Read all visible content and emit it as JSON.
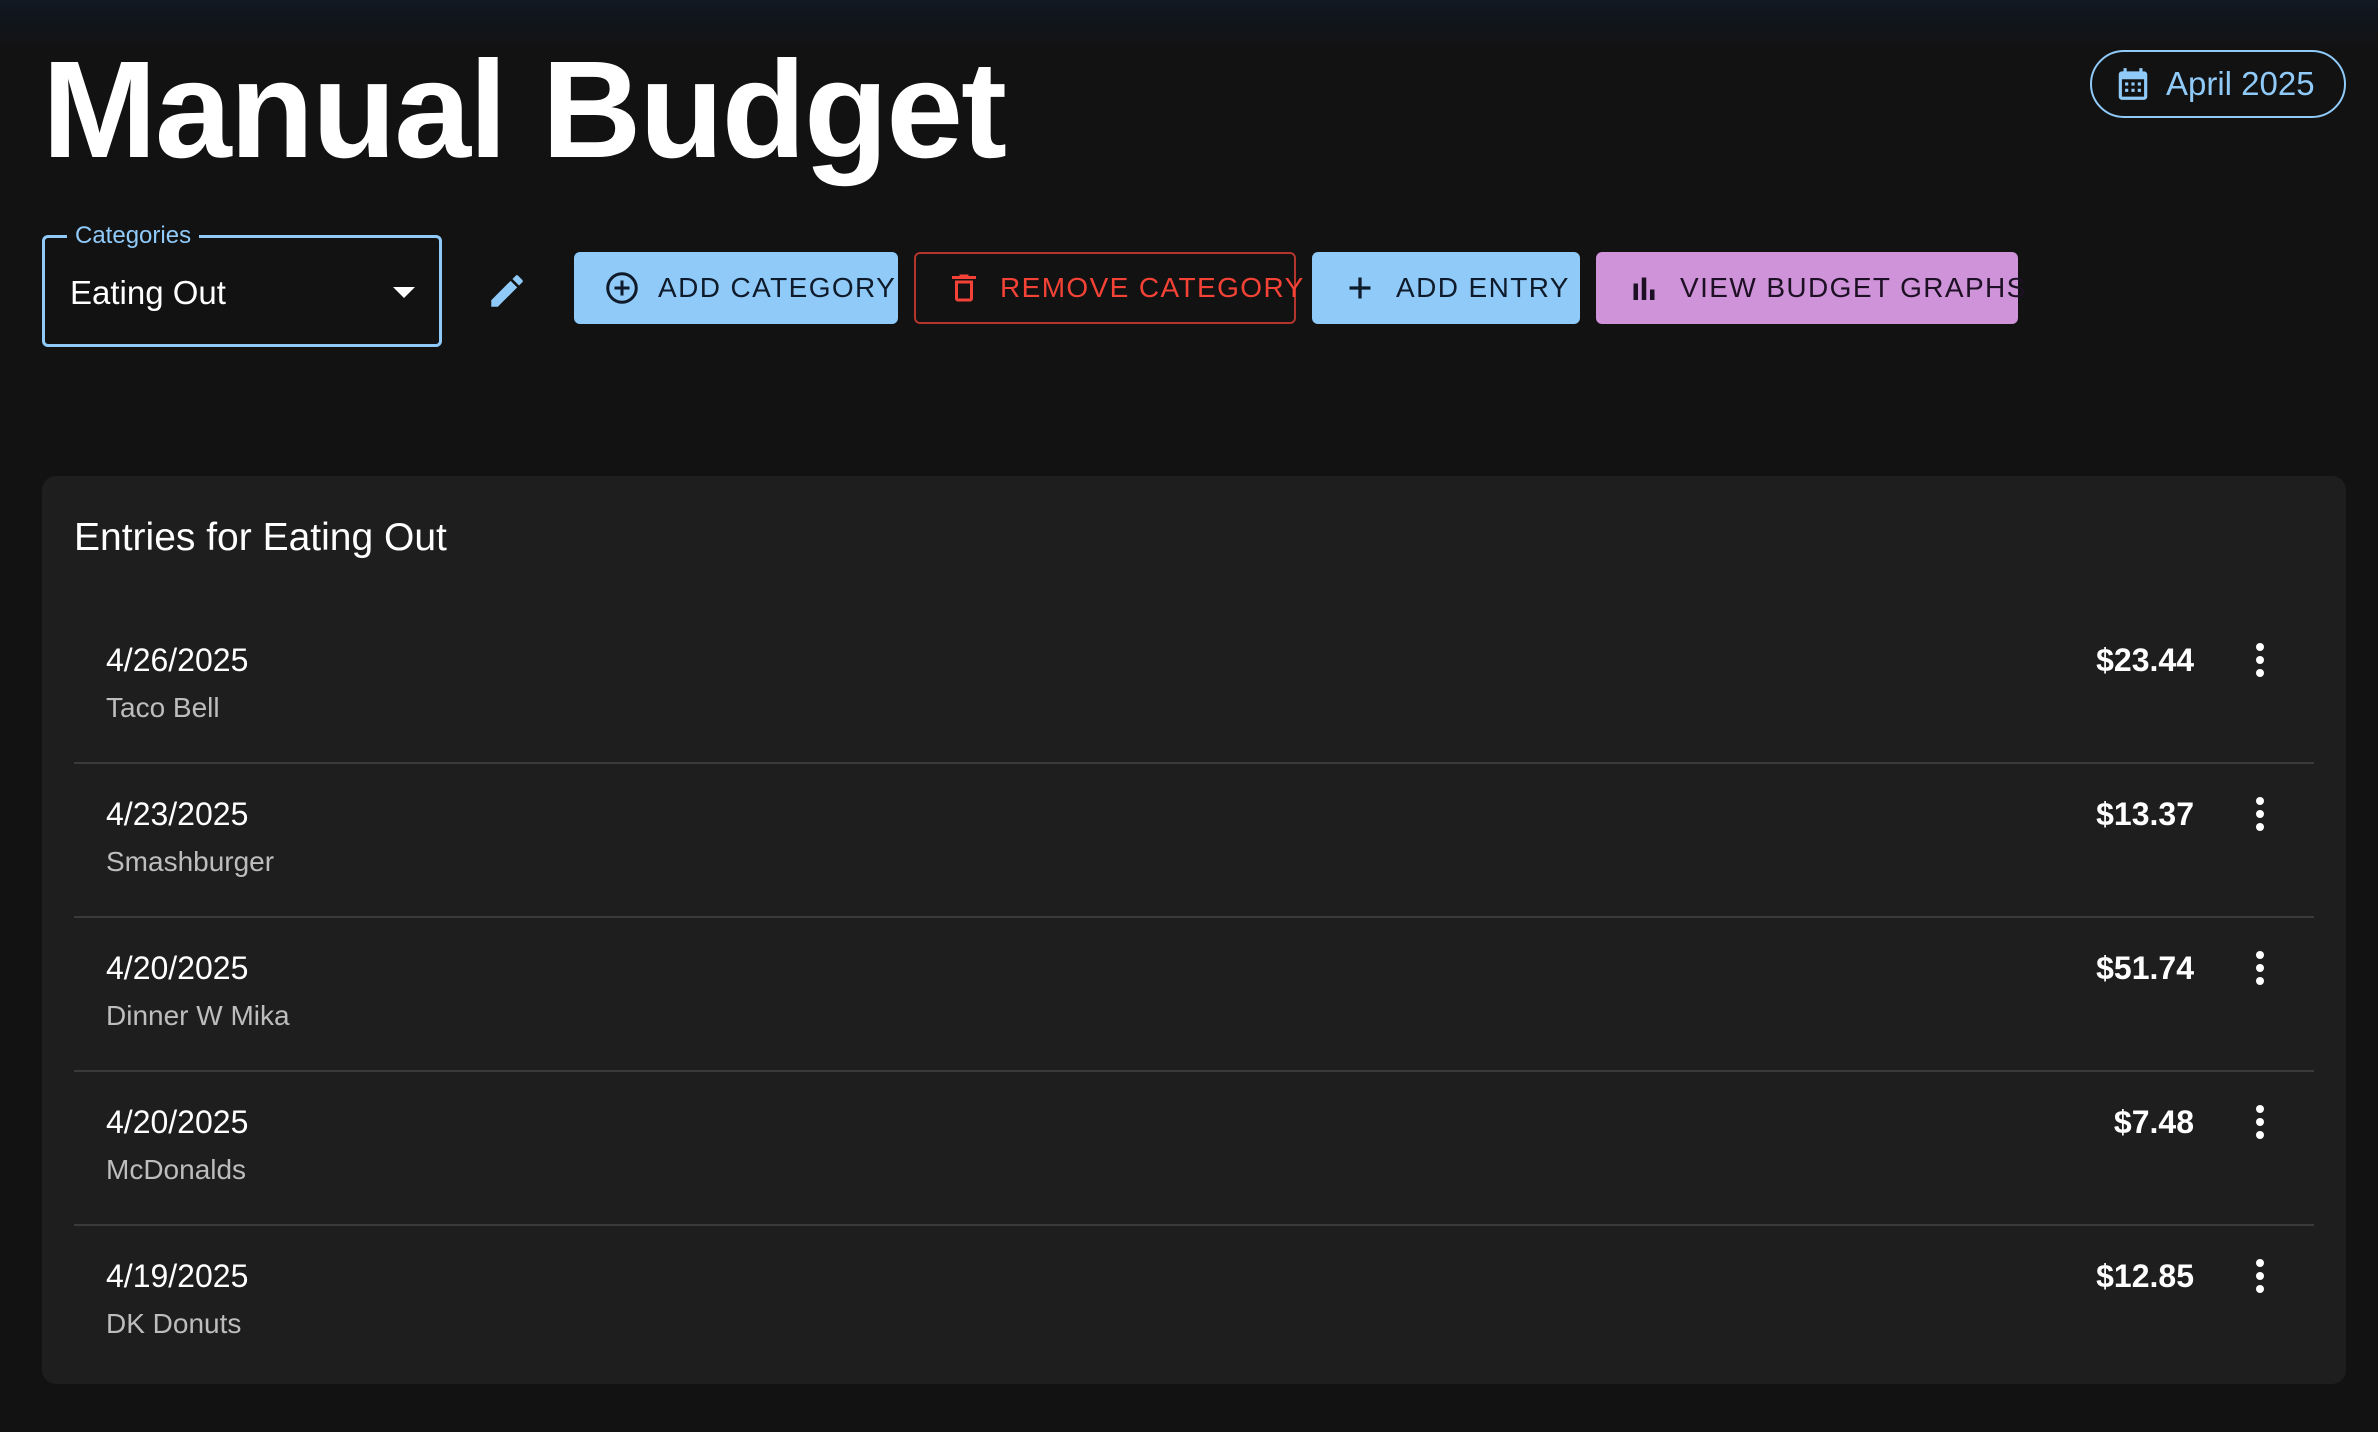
{
  "header": {
    "title": "Manual Budget",
    "month_label": "April 2025"
  },
  "toolbar": {
    "category_select": {
      "legend": "Categories",
      "value": "Eating Out"
    },
    "add_category_label": "Add Category",
    "remove_category_label": "Remove Category",
    "add_entry_label": "Add Entry",
    "view_graphs_label": "View Budget Graphs"
  },
  "entries_card": {
    "title": "Entries for Eating Out",
    "entries": [
      {
        "date": "4/26/2025",
        "description": "Taco Bell",
        "amount": "$23.44"
      },
      {
        "date": "4/23/2025",
        "description": "Smashburger",
        "amount": "$13.37"
      },
      {
        "date": "4/20/2025",
        "description": "Dinner W Mika",
        "amount": "$51.74"
      },
      {
        "date": "4/20/2025",
        "description": "McDonalds",
        "amount": "$7.48"
      },
      {
        "date": "4/19/2025",
        "description": "DK Donuts",
        "amount": "$12.85"
      }
    ]
  },
  "icons": {
    "month_chip": "calendar-icon",
    "edit": "pencil-icon",
    "add_category": "add-circle-icon",
    "remove_category": "trash-icon",
    "add_entry": "plus-icon",
    "view_graphs": "bar-chart-icon",
    "entry_menu": "more-vertical-icon"
  },
  "colors": {
    "background": "#121212",
    "card": "#1e1e1e",
    "primary": "#90caf9",
    "error": "#f44336",
    "secondary": "#ce93d8"
  }
}
